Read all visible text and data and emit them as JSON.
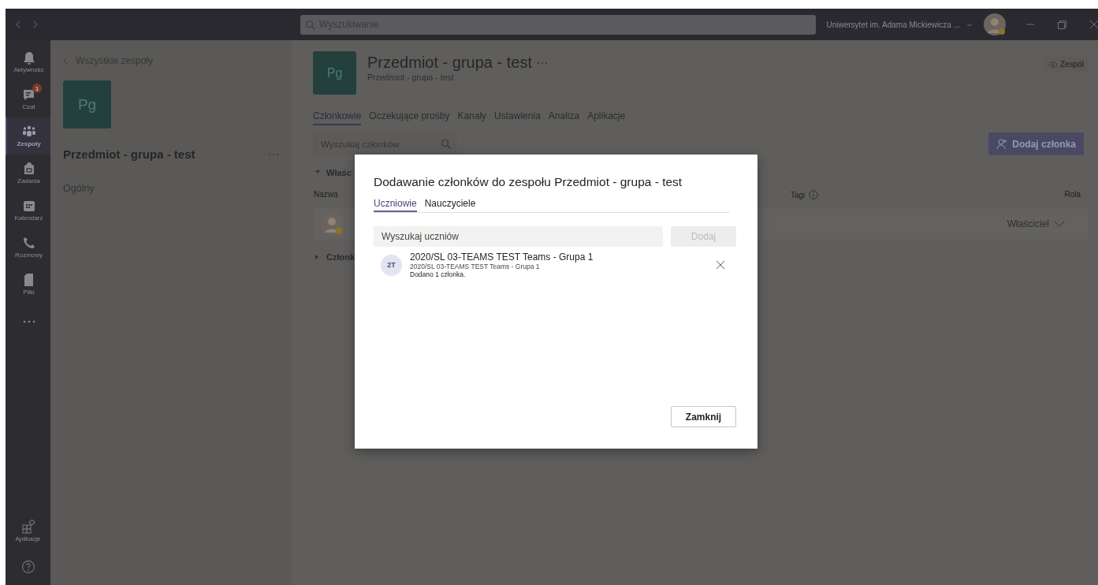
{
  "titlebar": {
    "search_placeholder": "Wyszukiwanie",
    "org": "Uniwersytet im. Adama Mickiewicza ..."
  },
  "rail": [
    {
      "kind": "bell",
      "label": "Aktywność",
      "selected": false
    },
    {
      "kind": "chat",
      "label": "Czat",
      "selected": false,
      "badge": "1"
    },
    {
      "kind": "teams",
      "label": "Zespoły",
      "selected": true
    },
    {
      "kind": "bag",
      "label": "Zadania",
      "selected": false
    },
    {
      "kind": "calendar",
      "label": "Kalendarz",
      "selected": false
    },
    {
      "kind": "phone",
      "label": "Rozmowy",
      "selected": false
    },
    {
      "kind": "file",
      "label": "Pliki",
      "selected": false
    },
    {
      "kind": "more",
      "selected": false
    }
  ],
  "rail_bottom": [
    {
      "kind": "apps",
      "label": "Aplikacje"
    },
    {
      "kind": "help"
    }
  ],
  "left_panel": {
    "back": "Wszystkie zespoły",
    "tile": "Pg",
    "team": "Przedmiot - grupa - test",
    "channels": [
      "Ogólny"
    ]
  },
  "team_header": {
    "tile": "Pg",
    "title": "Przedmiot - grupa - test",
    "subtitle": "Przedmiot - grupa - test",
    "team_button": "Zespół"
  },
  "tabs": [
    {
      "label": "Członkowie",
      "selected": true
    },
    {
      "label": "Oczekujące prośby",
      "selected": false
    },
    {
      "label": "Kanały",
      "selected": false
    },
    {
      "label": "Ustawienia",
      "selected": false
    },
    {
      "label": "Analiza",
      "selected": false
    },
    {
      "label": "Aplikacje",
      "selected": false
    }
  ],
  "member_search": {
    "placeholder": "Wyszukaj członków"
  },
  "add_member_button": "Dodaj członka",
  "columns": [
    "Nazwa",
    "Tagi",
    "Rola"
  ],
  "sections": [
    {
      "label": "Właśc",
      "expanded": true,
      "rows": [
        {
          "role": "Właściciel"
        }
      ]
    },
    {
      "label": "Członk",
      "expanded": false
    }
  ],
  "dialog": {
    "title": "Dodawanie członków do zespołu Przedmiot - grupa - test",
    "tabs": [
      {
        "label": "Uczniowie",
        "selected": true
      },
      {
        "label": "Nauczyciele",
        "selected": false
      }
    ],
    "search": {
      "placeholder": "Wyszukaj uczniów"
    },
    "add_button": {
      "label": "Dodaj",
      "disabled": true
    },
    "items": [
      {
        "initials": "2T",
        "name": "2020/SL 03-TEAMS TEST Teams - Grupa 1",
        "detail": "2020/SL 03-TEAMS TEST Teams - Grupa 1",
        "status": "Dodano 1 członka."
      }
    ],
    "close_button": "Zamknij"
  }
}
